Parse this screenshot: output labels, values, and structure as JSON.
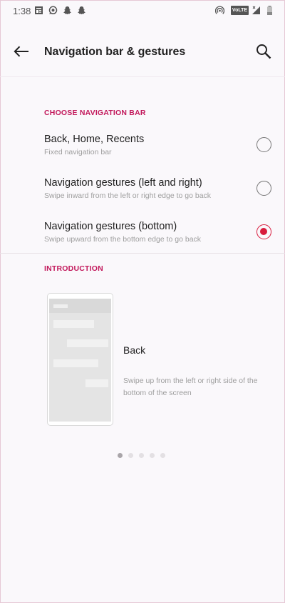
{
  "status_bar": {
    "time": "1:38",
    "left_icons": [
      "news-icon",
      "whatsapp-icon",
      "snapchat-icon",
      "snapchat-icon"
    ],
    "right_icons": [
      "hotspot-icon",
      "volte-icon",
      "signal-icon",
      "battery-icon"
    ],
    "volte_label": "VoLTE"
  },
  "header": {
    "title": "Navigation bar & gestures",
    "back_icon": "arrow-left-icon",
    "search_icon": "search-icon"
  },
  "navigation_section": {
    "header": "CHOOSE NAVIGATION BAR",
    "options": [
      {
        "title": "Back, Home, Recents",
        "subtitle": "Fixed navigation bar",
        "selected": false
      },
      {
        "title": "Navigation gestures (left and right)",
        "subtitle": "Swipe inward from the left or right edge to go back",
        "selected": false
      },
      {
        "title": "Navigation gestures (bottom)",
        "subtitle": "Swipe upward from the bottom edge to go back",
        "selected": true
      }
    ]
  },
  "introduction": {
    "header": "INTRODUCTION",
    "gesture_title": "Back",
    "gesture_description": "Swipe up from the left or right side of the bottom of the screen",
    "page_count": 5,
    "current_page": 1
  },
  "colors": {
    "accent": "#c2185b",
    "radio_selected": "#d81b3c",
    "background": "#faf8fb"
  }
}
